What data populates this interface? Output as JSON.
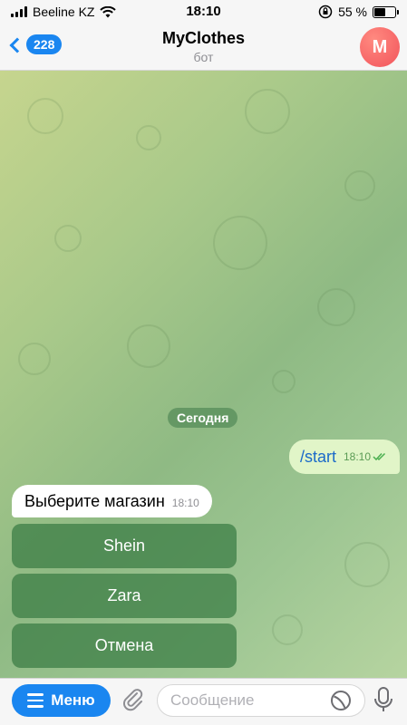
{
  "status_bar": {
    "carrier": "Beeline KZ",
    "time": "18:10",
    "battery": "55 %",
    "battery_level": 0.55
  },
  "header": {
    "back_count": "228",
    "title": "MyClothes",
    "subtitle": "бот",
    "avatar_letter": "M"
  },
  "chat": {
    "date_label": "Сегодня",
    "outgoing": {
      "text": "/start",
      "time": "18:10"
    },
    "incoming": {
      "text": "Выберите магазин",
      "time": "18:10"
    },
    "keyboard": [
      "Shein",
      "Zara",
      "Отмена"
    ]
  },
  "bottom_bar": {
    "menu_label": "Меню",
    "input_placeholder": "Сообщение"
  },
  "colors": {
    "accent": "#1a86f0",
    "avatar": "#f2545b",
    "outgoing_bubble": "#e1f5c8",
    "keyboard_button": "#3c7d46"
  }
}
